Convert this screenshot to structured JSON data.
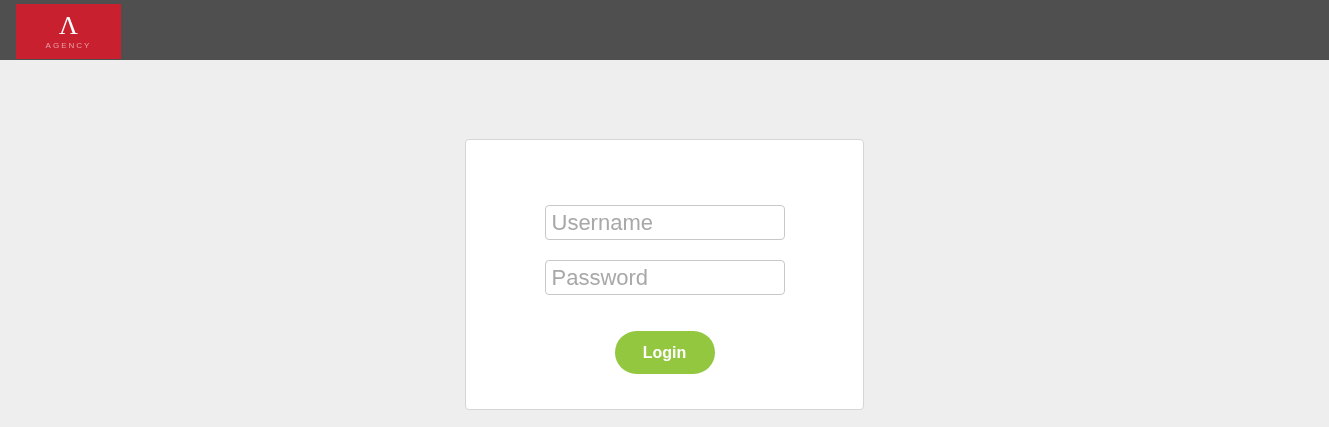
{
  "header": {
    "logo": {
      "mark": "Λ",
      "name": "AGENCY"
    }
  },
  "login": {
    "fields": [
      {
        "placeholder": "Username"
      },
      {
        "placeholder": "Password"
      }
    ],
    "button": "Login"
  }
}
